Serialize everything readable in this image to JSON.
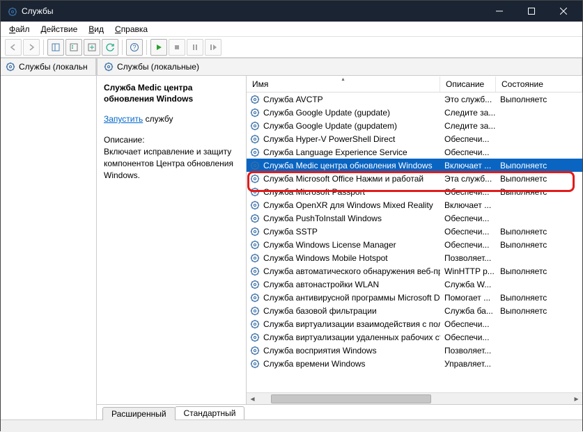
{
  "window": {
    "title": "Службы"
  },
  "menu": {
    "file": "Файл",
    "action": "Действие",
    "view": "Вид",
    "help": "Справка"
  },
  "nav": {
    "local": "Службы (локальн"
  },
  "panel_header": "Службы (локальные)",
  "columns": {
    "name": "Имя",
    "desc": "Описание",
    "state": "Состояние"
  },
  "detail": {
    "title": "Служба Medic центра обновления Windows",
    "start_link": "Запустить",
    "start_rest": " службу",
    "desc_label": "Описание:",
    "desc_text": "Включает исправление и защиту компонентов Центра обновления Windows."
  },
  "tabs": {
    "extended": "Расширенный",
    "standard": "Стандартный"
  },
  "services": [
    {
      "name": "Служба AVCTP",
      "desc": "Это служб...",
      "state": "Выполняетс",
      "sel": false
    },
    {
      "name": "Служба Google Update (gupdate)",
      "desc": "Следите за...",
      "state": "",
      "sel": false
    },
    {
      "name": "Служба Google Update (gupdatem)",
      "desc": "Следите за...",
      "state": "",
      "sel": false
    },
    {
      "name": "Служба Hyper-V PowerShell Direct",
      "desc": "Обеспечи...",
      "state": "",
      "sel": false
    },
    {
      "name": "Служба Language Experience Service",
      "desc": "Обеспечи...",
      "state": "",
      "sel": false
    },
    {
      "name": "Служба Medic центра обновления Windows",
      "desc": "Включает ...",
      "state": "Выполняетс",
      "sel": true
    },
    {
      "name": "Служба Microsoft Office  Нажми и работай",
      "desc": "Эта служб...",
      "state": "Выполняетс",
      "sel": false
    },
    {
      "name": "Служба Microsoft Passport",
      "desc": "Обеспечи...",
      "state": "Выполняетс",
      "sel": false
    },
    {
      "name": "Служба OpenXR для Windows Mixed Reality",
      "desc": "Включает ...",
      "state": "",
      "sel": false
    },
    {
      "name": "Служба PushToInstall Windows",
      "desc": "Обеспечи...",
      "state": "",
      "sel": false
    },
    {
      "name": "Служба SSTP",
      "desc": "Обеспечи...",
      "state": "Выполняетс",
      "sel": false
    },
    {
      "name": "Служба Windows License Manager",
      "desc": "Обеспечи...",
      "state": "Выполняетс",
      "sel": false
    },
    {
      "name": "Служба Windows Mobile Hotspot",
      "desc": "Позволяет...",
      "state": "",
      "sel": false
    },
    {
      "name": "Служба автоматического обнаружения веб-пр...",
      "desc": "WinHTTP р...",
      "state": "Выполняетс",
      "sel": false
    },
    {
      "name": "Служба автонастройки WLAN",
      "desc": "Служба W...",
      "state": "",
      "sel": false
    },
    {
      "name": "Служба антивирусной программы Microsoft D...",
      "desc": "Помогает ...",
      "state": "Выполняетс",
      "sel": false
    },
    {
      "name": "Служба базовой фильтрации",
      "desc": "Служба ба...",
      "state": "Выполняетс",
      "sel": false
    },
    {
      "name": "Служба виртуализации взаимодействия с поль...",
      "desc": "Обеспечи...",
      "state": "",
      "sel": false
    },
    {
      "name": "Служба виртуализации удаленных рабочих ст...",
      "desc": "Обеспечи...",
      "state": "",
      "sel": false
    },
    {
      "name": "Служба восприятия Windows",
      "desc": "Позволяет...",
      "state": "",
      "sel": false
    },
    {
      "name": "Служба времени Windows",
      "desc": "Управляет...",
      "state": "",
      "sel": false
    }
  ]
}
